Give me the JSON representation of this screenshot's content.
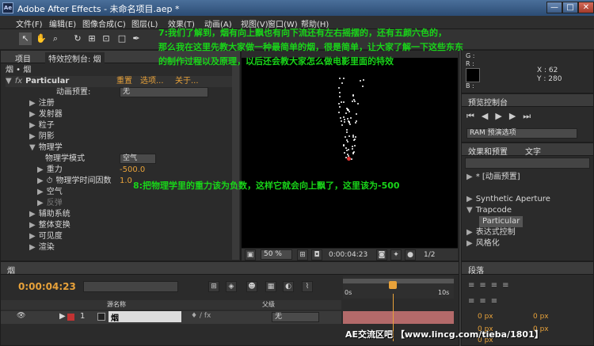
{
  "title": "Adobe After Effects - 未命名项目.aep *",
  "window_buttons": [
    "—",
    "□",
    "✕"
  ],
  "menu": [
    "文件(F)",
    "编辑(E)",
    "图像合成(C)",
    "图层(L)",
    "效果(T)",
    "动画(A)",
    "视图(V)",
    "窗口(W)",
    "帮助(H)"
  ],
  "left_panel": {
    "tab_project": "项目",
    "tab_effects": "特效控制台: 烟",
    "breadcrumb": "烟 • 烟",
    "effect_name": "Particular",
    "reset": "重置",
    "options": "选项...",
    "about": "关于...",
    "preset_label": "动画预置:",
    "preset_value": "无",
    "props": [
      {
        "label": "注册",
        "indent": 1
      },
      {
        "label": "发射器",
        "indent": 1
      },
      {
        "label": "粒子",
        "indent": 1
      },
      {
        "label": "阴影",
        "indent": 1
      },
      {
        "label": "物理学",
        "indent": 1,
        "open": true
      },
      {
        "label": "物理学模式",
        "indent": 2
      },
      {
        "label": "重力",
        "indent": 2
      },
      {
        "label": "物理学时间因数",
        "indent": 2
      },
      {
        "label": "空气",
        "indent": 2
      },
      {
        "label": "反弹",
        "indent": 2,
        "dim": true
      },
      {
        "label": "辅助系统",
        "indent": 1
      },
      {
        "label": "整体变换",
        "indent": 1
      },
      {
        "label": "可见度",
        "indent": 1
      },
      {
        "label": "渲染",
        "indent": 1
      }
    ],
    "physics_mode": "空气",
    "gravity": "-500.0",
    "time_factor": "1.0"
  },
  "caption_top": [
    "7:我们了解到，烟有向上飘也有向下流还有左右摇摆的，还有五颜六色的，",
    "那么我在这里先教大家做一种最简单的烟，很是简单，让大家了解一下这些东东",
    "的制作过程以及原理，以后还会教大家怎么做电影里面的特效"
  ],
  "caption_mid": "8:把物理学里的重力该为负数，这样它就会向上飘了，这里该为-500",
  "viewer": {
    "zoom": "50 %",
    "timecode": "0:00:04:23",
    "resolution": "1/2"
  },
  "info": {
    "r": "R :",
    "g": "G :",
    "b": "B :",
    "x": "X : 62",
    "y": "Y : 280"
  },
  "preview": {
    "tab": "预览控制台",
    "ram": "RAM 预演选项"
  },
  "effects_panel": {
    "tab1": "效果和预置",
    "tab2": "文字",
    "items": [
      "* [动画预置]",
      "Synthetic Aperture",
      "Trapcode",
      "Particular",
      "表达式控制",
      "风格化"
    ]
  },
  "timeline": {
    "tab": "烟",
    "timecode": "0:00:04:23",
    "col_name": "源名称",
    "col_parent": "父级",
    "layer_num": "1",
    "layer_name": "烟",
    "parent_value": "无",
    "ruler_start": "0s",
    "ruler_end": "10s"
  },
  "paragraph": {
    "tab": "段落",
    "px": [
      "0 px",
      "0 px",
      "0 px",
      "0 px",
      "0 px"
    ]
  },
  "watermark": "AE交流区吧 【www.lincg.com/tieba/1801】"
}
